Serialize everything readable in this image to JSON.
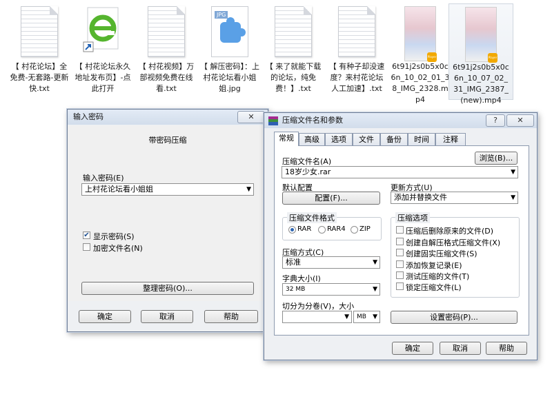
{
  "files": [
    {
      "type": "txt",
      "name": "【 村花论坛】全免费-无套路-更新快.txt"
    },
    {
      "type": "url",
      "name": "【 村花论坛永久地址发布页】-点此打开"
    },
    {
      "type": "txt",
      "name": "【 村花视频】万部视频免费在线看.txt"
    },
    {
      "type": "jpg",
      "name": "【 解压密码】：上村花论坛看小姐姐.jpg",
      "badge": "JPG"
    },
    {
      "type": "txt",
      "name": "【 来了就能下载的论坛，纯免费！】.txt"
    },
    {
      "type": "txt",
      "name": "【 有种子却没速度？来村花论坛人工加速】.txt"
    },
    {
      "type": "mp4",
      "name": "6t91j2s0b5x0c6n_10_02_01_38_IMG_2328.mp4",
      "badge": "Player"
    },
    {
      "type": "mp4",
      "name": "6t91j2s0b5x0c6n_10_07_02_31_IMG_2387_(new).mp4",
      "badge": "Player"
    }
  ],
  "password_dialog": {
    "title": "输入密码",
    "close": "✕",
    "heading": "带密码压缩",
    "input_label": "输入密码(E)",
    "input_value": "上村花论坛看小姐姐",
    "show_password": "显示密码(S)",
    "show_password_checked": true,
    "encrypt_names": "加密文件名(N)",
    "encrypt_names_checked": false,
    "organize": "整理密码(O)...",
    "ok": "确定",
    "cancel": "取消",
    "help": "帮助"
  },
  "archive_dialog": {
    "title": "压缩文件名和参数",
    "help_icon": "?",
    "close": "✕",
    "tabs": [
      "常规",
      "高级",
      "选项",
      "文件",
      "备份",
      "时间",
      "注释"
    ],
    "active_tab": "常规",
    "filename_label": "压缩文件名(A)",
    "browse": "浏览(B)...",
    "filename_value": "18岁少女.rar",
    "default_config_label": "默认配置",
    "config_button": "配置(F)...",
    "update_mode_label": "更新方式(U)",
    "update_mode_value": "添加并替换文件",
    "format_group": "压缩文件格式",
    "formats": [
      "RAR",
      "RAR4",
      "ZIP"
    ],
    "format_selected": "RAR",
    "method_label": "压缩方式(C)",
    "method_value": "标准",
    "dict_label": "字典大小(I)",
    "dict_value": "32 MB",
    "split_label": "切分为分卷(V)，大小",
    "split_value": "",
    "split_unit": "MB",
    "options_group": "压缩选项",
    "options": [
      "压缩后删除原来的文件(D)",
      "创建自解压格式压缩文件(X)",
      "创建固实压缩文件(S)",
      "添加恢复记录(E)",
      "测试压缩的文件(T)",
      "锁定压缩文件(L)"
    ],
    "set_password": "设置密码(P)...",
    "ok": "确定",
    "cancel": "取消",
    "help": "帮助"
  }
}
